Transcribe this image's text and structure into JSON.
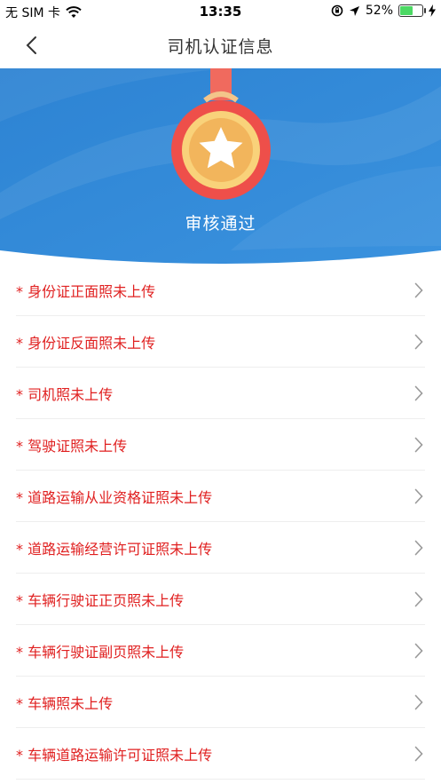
{
  "status_bar": {
    "carrier": "无 SIM 卡",
    "time": "13:35",
    "battery_percent": "52%",
    "battery_level": 0.52
  },
  "nav": {
    "title": "司机认证信息",
    "back_icon": "chevron-left-icon"
  },
  "banner": {
    "status_text": "审核通过",
    "medal_icon": "medal-star-icon",
    "colors": {
      "blue": "#2f86d6",
      "medal_red": "#ef5350",
      "ribbon": "#f06a5e",
      "inner_gold": "#f9d27a"
    }
  },
  "items": [
    {
      "label": "* 身份证正面照未上传"
    },
    {
      "label": "* 身份证反面照未上传"
    },
    {
      "label": "* 司机照未上传"
    },
    {
      "label": "* 驾驶证照未上传"
    },
    {
      "label": "* 道路运输从业资格证照未上传"
    },
    {
      "label": "* 道路运输经营许可证照未上传"
    },
    {
      "label": "* 车辆行驶证正页照未上传"
    },
    {
      "label": "* 车辆行驶证副页照未上传"
    },
    {
      "label": "* 车辆照未上传"
    },
    {
      "label": "* 车辆道路运输许可证照未上传"
    }
  ],
  "colors": {
    "warning_text": "#e02020",
    "divider": "#eeeeee"
  }
}
